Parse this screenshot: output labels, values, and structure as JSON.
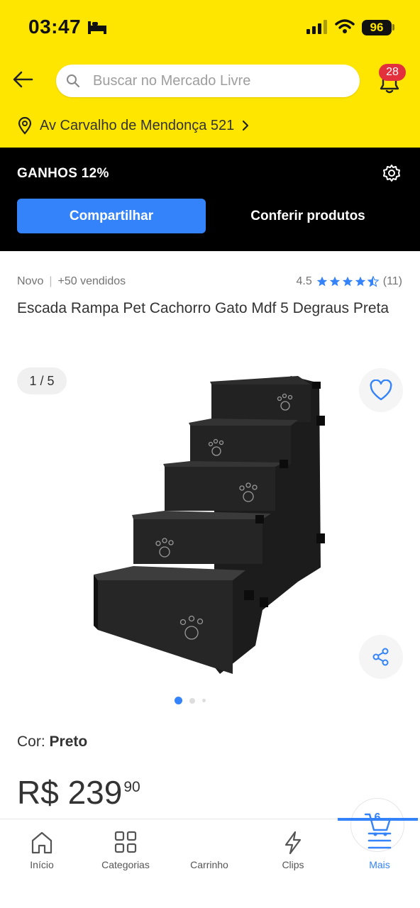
{
  "status_bar": {
    "time": "03:47",
    "battery": "96"
  },
  "header": {
    "search_placeholder": "Buscar no Mercado Livre",
    "notifications": "28",
    "address": "Av Carvalho de Mendonça 521"
  },
  "affiliate": {
    "title": "GANHOS 12%",
    "share_label": "Compartilhar",
    "check_label": "Conferir produtos"
  },
  "product": {
    "condition": "Novo",
    "sold": "+50 vendidos",
    "rating": "4.5",
    "rating_stars": 4.5,
    "reviews": "(11)",
    "title": "Escada Rampa Pet Cachorro Gato Mdf 5 Degraus Preta",
    "image_counter": "1 / 5",
    "color_label": "Cor:",
    "color_value": "Preto",
    "price_main": "R$ 239",
    "price_cents": "90"
  },
  "nav": {
    "home": "Início",
    "categories": "Categorias",
    "cart": "Carrinho",
    "cart_count": "6",
    "clips": "Clips",
    "more": "Mais"
  },
  "colors": {
    "brand_yellow": "#ffe600",
    "accent_blue": "#3483fa",
    "badge_red": "#e3303d"
  }
}
